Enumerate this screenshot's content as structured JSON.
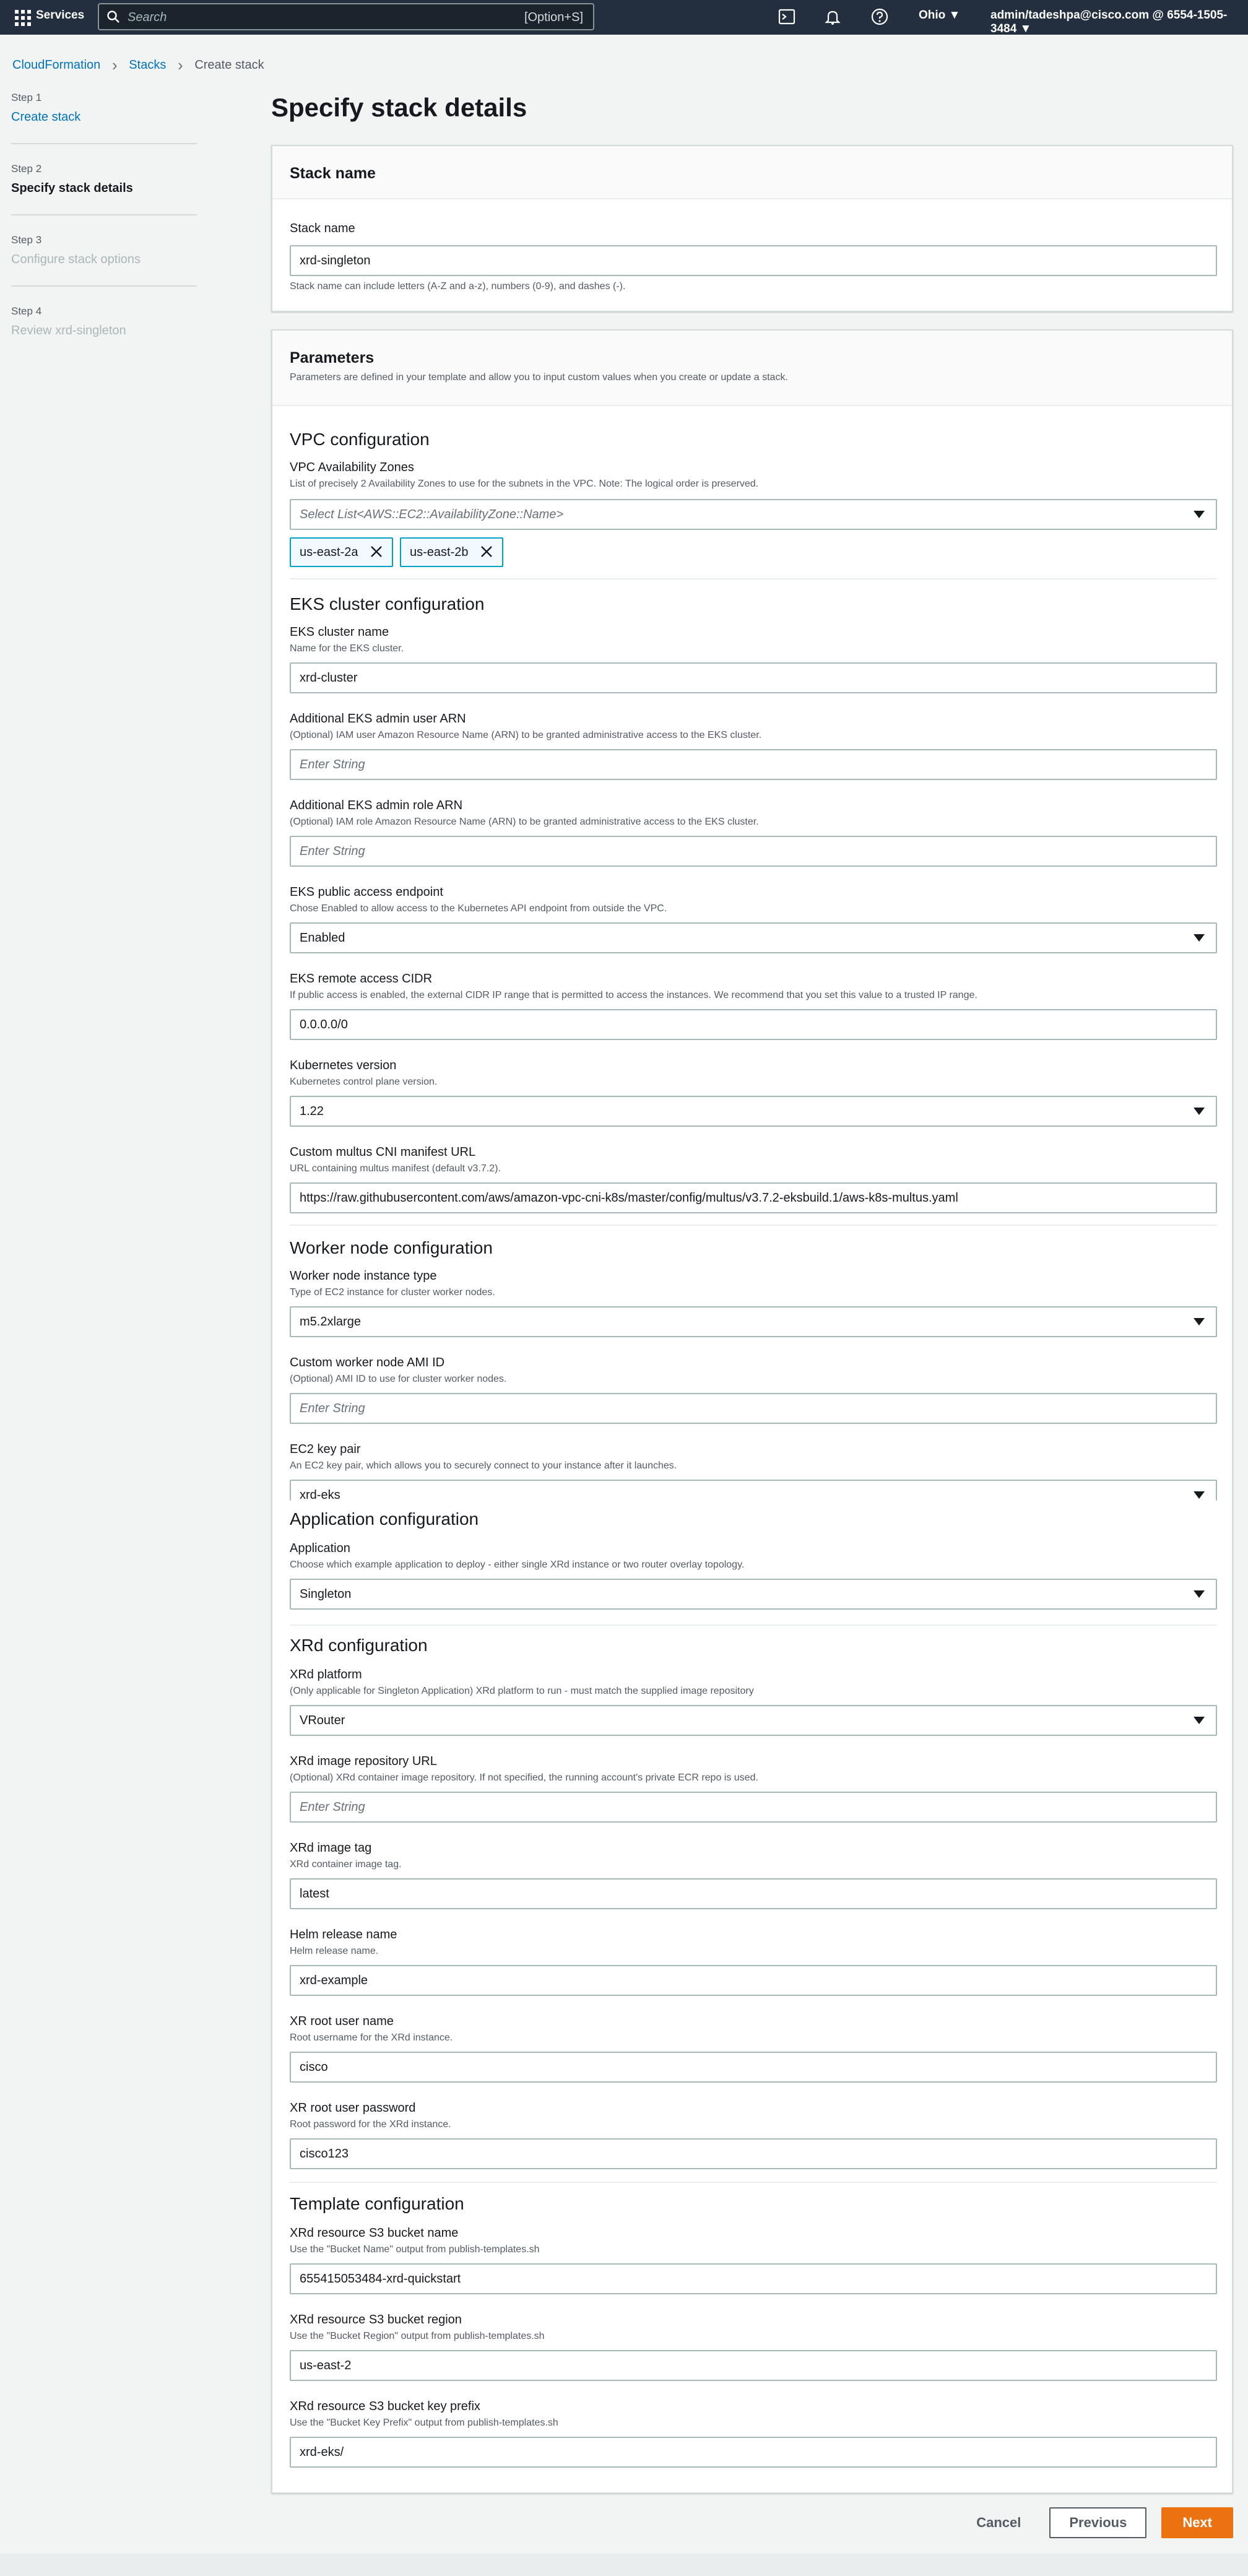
{
  "topnav": {
    "services_label": "Services",
    "search_placeholder": "Search",
    "search_shortcut": "[Option+S]",
    "region": "Ohio ▼",
    "account": "admin/tadeshpa@cisco.com @ 6554-1505-3484 ▼"
  },
  "breadcrumb": {
    "items": [
      "CloudFormation",
      "Stacks",
      "Create stack"
    ]
  },
  "steps": [
    {
      "label": "Step 1",
      "title": "Create stack"
    },
    {
      "label": "Step 2",
      "title": "Specify stack details"
    },
    {
      "label": "Step 3",
      "title": "Configure stack options"
    },
    {
      "label": "Step 4",
      "title": "Review xrd-singleton"
    }
  ],
  "page_title": "Specify stack details",
  "stack_name": {
    "header": "Stack name",
    "label": "Stack name",
    "value": "xrd-singleton",
    "constraint": "Stack name can include letters (A-Z and a-z), numbers (0-9), and dashes (-)."
  },
  "parameters": {
    "header": "Parameters",
    "description": "Parameters are defined in your template and allow you to input custom values when you create or update a stack.",
    "vpc": {
      "title": "VPC configuration",
      "azs": {
        "label": "VPC Availability Zones",
        "desc": "List of precisely 2 Availability Zones to use for the subnets in the VPC. Note: The logical order is preserved.",
        "placeholder": "Select List<AWS::EC2::AvailabilityZone::Name>",
        "tokens": [
          "us-east-2a",
          "us-east-2b"
        ]
      }
    },
    "eks": {
      "title": "EKS cluster configuration",
      "cluster_name": {
        "label": "EKS cluster name",
        "desc": "Name for the EKS cluster.",
        "value": "xrd-cluster"
      },
      "admin_user_arn": {
        "label": "Additional EKS admin user ARN",
        "desc": "(Optional) IAM user Amazon Resource Name (ARN) to be granted administrative access to the EKS cluster.",
        "placeholder": "Enter String"
      },
      "admin_role_arn": {
        "label": "Additional EKS admin role ARN",
        "desc": "(Optional) IAM role Amazon Resource Name (ARN) to be granted administrative access to the EKS cluster.",
        "placeholder": "Enter String"
      },
      "public_endpoint": {
        "label": "EKS public access endpoint",
        "desc": "Chose Enabled to allow access to the Kubernetes API endpoint from outside the VPC.",
        "value": "Enabled"
      },
      "remote_cidr": {
        "label": "EKS remote access CIDR",
        "desc": "If public access is enabled, the external CIDR IP range that is permitted to access the instances. We recommend that you set this value to a trusted IP range.",
        "value": "0.0.0.0/0"
      },
      "k8s_version": {
        "label": "Kubernetes version",
        "desc": "Kubernetes control plane version.",
        "value": "1.22"
      },
      "multus_url": {
        "label": "Custom multus CNI manifest URL",
        "desc": "URL containing multus manifest (default v3.7.2).",
        "value": "https://raw.githubusercontent.com/aws/amazon-vpc-cni-k8s/master/config/multus/v3.7.2-eksbuild.1/aws-k8s-multus.yaml"
      }
    },
    "worker": {
      "title": "Worker node configuration",
      "instance_type": {
        "label": "Worker node instance type",
        "desc": "Type of EC2 instance for cluster worker nodes.",
        "value": "m5.2xlarge"
      },
      "ami_id": {
        "label": "Custom worker node AMI ID",
        "desc": "(Optional) AMI ID to use for cluster worker nodes.",
        "placeholder": "Enter String"
      },
      "key_pair": {
        "label": "EC2 key pair",
        "desc": "An EC2 key pair, which allows you to securely connect to your instance after it launches.",
        "value": "xrd-eks"
      }
    },
    "application": {
      "title": "Application configuration",
      "app": {
        "label": "Application",
        "desc": "Choose which example application to deploy - either single XRd instance or two router overlay topology.",
        "value": "Singleton"
      }
    },
    "xrd": {
      "title": "XRd configuration",
      "platform": {
        "label": "XRd platform",
        "desc": "(Only applicable for Singleton Application) XRd platform to run - must match the supplied image repository",
        "value": "VRouter"
      },
      "repo_url": {
        "label": "XRd image repository URL",
        "desc": "(Optional) XRd container image repository. If not specified, the running account's private ECR repo is used.",
        "placeholder": "Enter String"
      },
      "image_tag": {
        "label": "XRd image tag",
        "desc": "XRd container image tag.",
        "value": "latest"
      },
      "helm_release": {
        "label": "Helm release name",
        "desc": "Helm release name.",
        "value": "xrd-example"
      },
      "root_user": {
        "label": "XR root user name",
        "desc": "Root username for the XRd instance.",
        "value": "cisco"
      },
      "root_password": {
        "label": "XR root user password",
        "desc": "Root password for the XRd instance.",
        "value": "cisco123"
      }
    },
    "template": {
      "title": "Template configuration",
      "bucket_name": {
        "label": "XRd resource S3 bucket name",
        "desc": "Use the \"Bucket Name\" output from publish-templates.sh",
        "value": "655415053484-xrd-quickstart"
      },
      "bucket_region": {
        "label": "XRd resource S3 bucket region",
        "desc": "Use the \"Bucket Region\" output from publish-templates.sh",
        "value": "us-east-2"
      },
      "key_prefix": {
        "label": "XRd resource S3 bucket key prefix",
        "desc": "Use the \"Bucket Key Prefix\" output from publish-templates.sh",
        "value": "xrd-eks/"
      }
    }
  },
  "footer": {
    "cancel": "Cancel",
    "previous": "Previous",
    "next": "Next"
  },
  "colors": {
    "topnav_bg": "#232f3e",
    "link": "#0073bb",
    "primary": "#ec7211",
    "token_border": "#00a1c9"
  }
}
